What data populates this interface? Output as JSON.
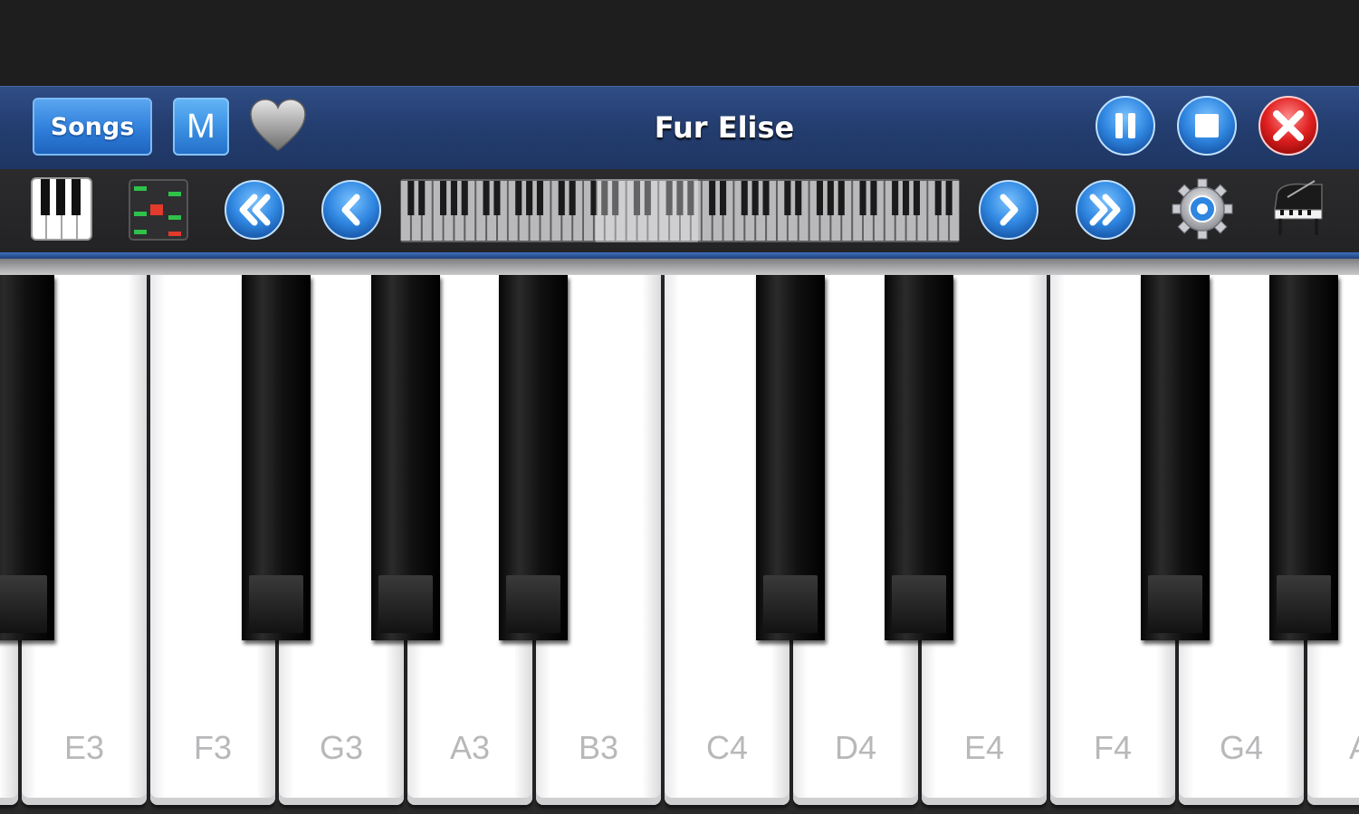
{
  "header": {
    "songs_label": "Songs",
    "m_label": "M",
    "title": "Fur Elise",
    "favorite_icon": "heart-icon",
    "pause_icon": "pause-icon",
    "stop_icon": "stop-icon",
    "close_icon": "close-icon"
  },
  "toolbar": {
    "piano_icon": "piano-keys-icon",
    "notes_icon": "note-grid-icon",
    "rewind_fast_icon": "double-chevron-left-icon",
    "rewind_icon": "chevron-left-icon",
    "forward_icon": "chevron-right-icon",
    "forward_fast_icon": "double-chevron-right-icon",
    "settings_icon": "gear-icon",
    "instrument_icon": "grand-piano-icon"
  },
  "keyboard": {
    "white_keys": [
      "E3",
      "F3",
      "G3",
      "A3",
      "B3",
      "C4",
      "D4",
      "E4",
      "F4",
      "G4",
      "A"
    ]
  },
  "colors": {
    "header_blue": "#2f4d86",
    "button_blue": "#2f7fdb",
    "close_red": "#e02020"
  }
}
